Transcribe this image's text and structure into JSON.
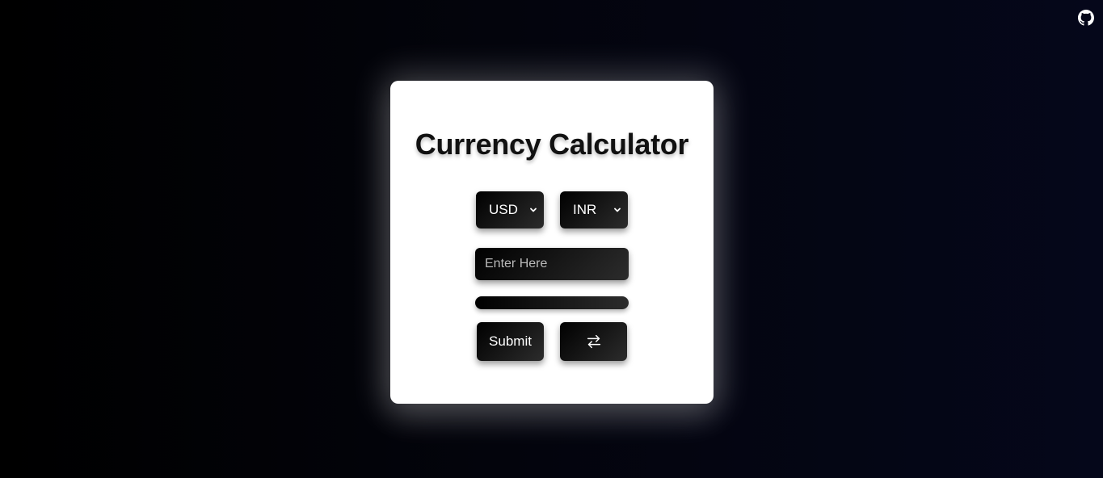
{
  "header": {
    "github_icon": "github-icon"
  },
  "calculator": {
    "title": "Currency Calculator",
    "from_currency": {
      "selected": "USD",
      "icon": "chevron-down-icon"
    },
    "to_currency": {
      "selected": "INR",
      "icon": "chevron-down-icon"
    },
    "amount_input": {
      "placeholder": "Enter Here",
      "value": ""
    },
    "result": "",
    "submit_label": "Submit",
    "swap_icon": "swap-arrows-icon"
  },
  "colors": {
    "background": "#000000",
    "card": "#ffffff",
    "control": "#111111",
    "text_light": "#ffffff"
  }
}
